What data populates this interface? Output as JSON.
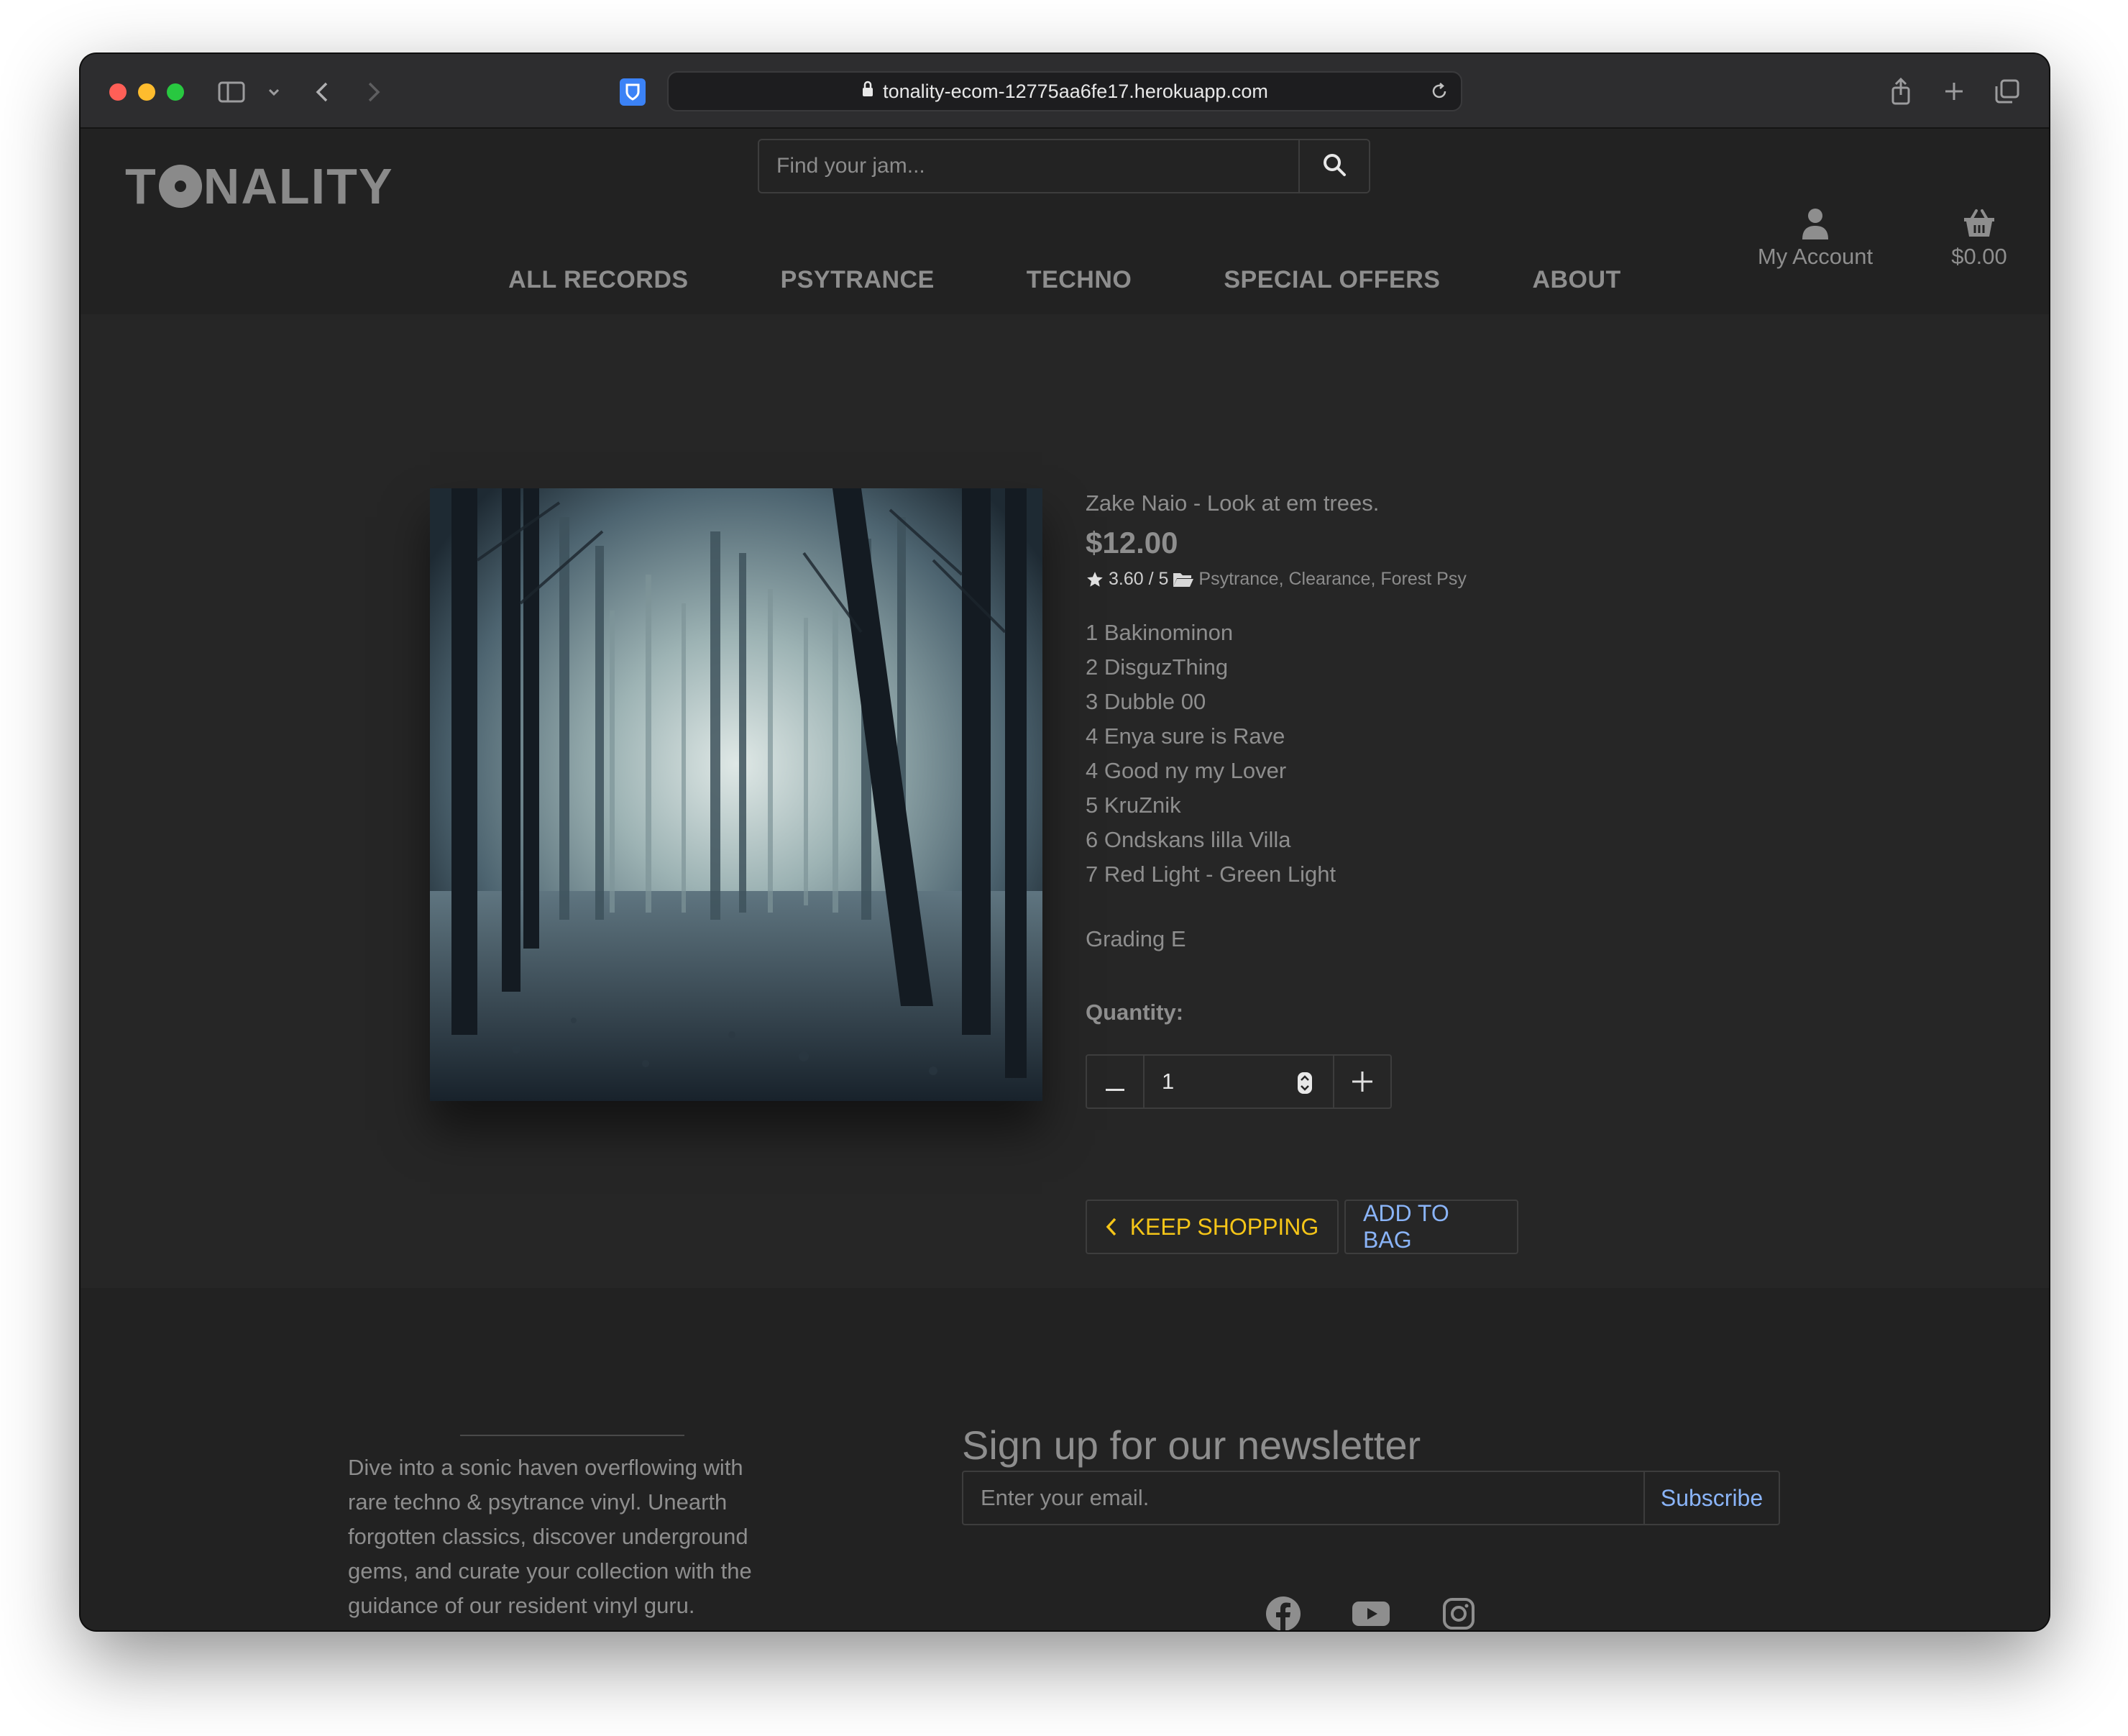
{
  "browser": {
    "url": "tonality-ecom-12775aa6fe17.herokuapp.com"
  },
  "site": {
    "logo": "TONALITY",
    "search_placeholder": "Find your jam...",
    "account_label": "My Account",
    "bag_total": "$0.00",
    "nav": [
      "ALL RECORDS",
      "PSYTRANCE",
      "TECHNO",
      "SPECIAL OFFERS",
      "ABOUT"
    ]
  },
  "product": {
    "title": "Zake Naio - Look at em trees.",
    "price": "$12.00",
    "rating": "3.60 / 5",
    "categories": [
      "Psytrance",
      "Clearance",
      "Forest Psy"
    ],
    "tracks": [
      "1 Bakinominon",
      "2 DisguzThing",
      "3 Dubble 00",
      "4 Enya sure is Rave",
      "4 Good ny my Lover",
      "5 KruZnik",
      "6 Ondskans lilla Villa",
      "7 Red Light - Green Light"
    ],
    "grading": "Grading E",
    "quantity_label": "Quantity:",
    "quantity": "1",
    "keep_shopping": "KEEP SHOPPING",
    "add_to_bag": "ADD TO BAG"
  },
  "footer": {
    "blurb": "Dive into a sonic haven overflowing with rare techno & psytrance vinyl. Unearth forgotten classics, discover underground gems, and curate your collection with the guidance of our resident vinyl guru. Welcome to the trip.",
    "newsletter_title": "Sign up for our newsletter",
    "email_placeholder": "Enter your email.",
    "subscribe": "Subscribe",
    "socials": [
      "facebook-icon",
      "youtube-icon",
      "instagram-icon"
    ]
  },
  "colors": {
    "accent_yellow": "#f5c518",
    "accent_blue": "#8ab4f8",
    "bg_dark": "#222222",
    "bg_main": "#262626"
  }
}
